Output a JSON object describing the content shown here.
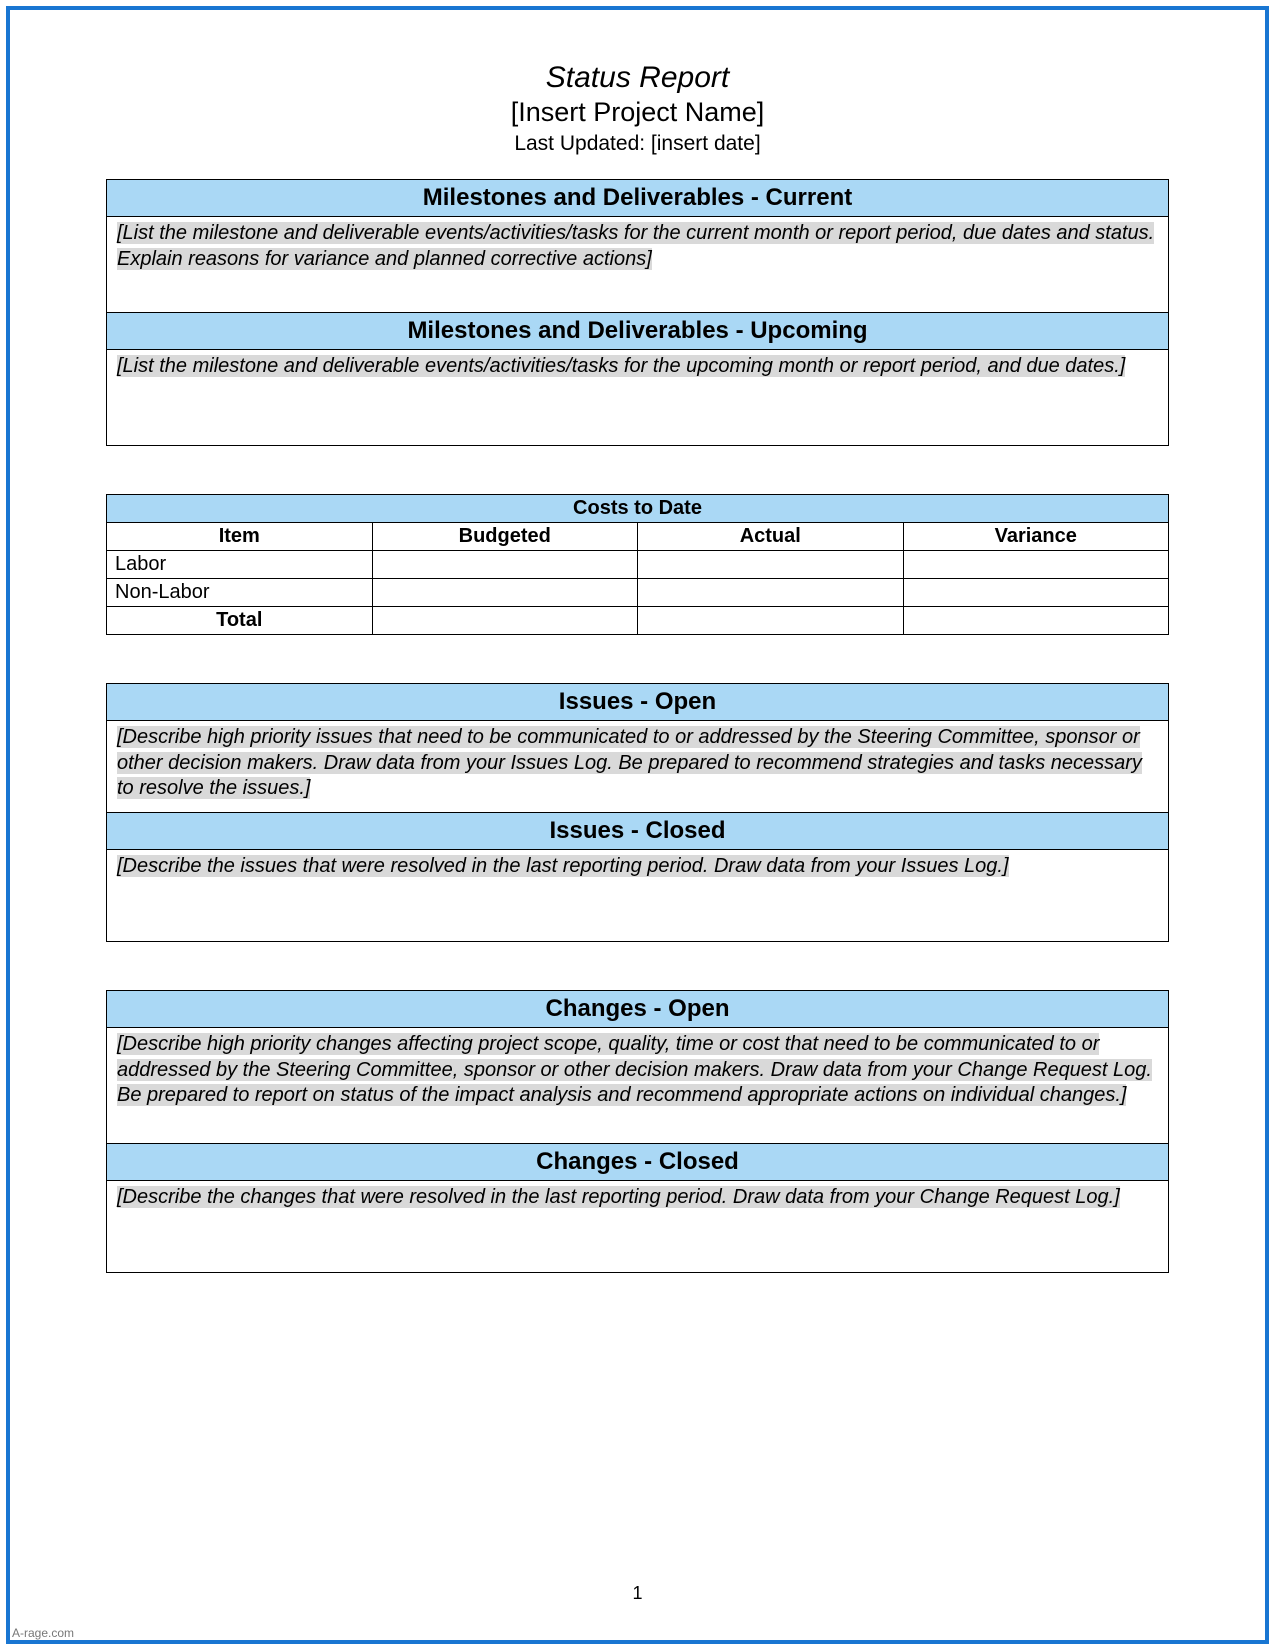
{
  "header": {
    "title": "Status Report",
    "project_name": "[Insert Project Name]",
    "last_updated_label": "Last Updated: [insert date]"
  },
  "milestones": {
    "current": {
      "title": "Milestones and Deliverables - Current",
      "body": "[List the milestone and deliverable events/activities/tasks for the current month or report period, due dates and status.  Explain reasons for variance and planned corrective actions]"
    },
    "upcoming": {
      "title": "Milestones and Deliverables - Upcoming",
      "body": "[List the milestone and deliverable events/activities/tasks for the upcoming month or report period, and due dates.]"
    }
  },
  "costs": {
    "title": "Costs to Date",
    "columns": {
      "item": "Item",
      "budgeted": "Budgeted",
      "actual": "Actual",
      "variance": "Variance"
    },
    "rows": [
      {
        "item": "Labor",
        "budgeted": "",
        "actual": "",
        "variance": ""
      },
      {
        "item": "Non-Labor",
        "budgeted": "",
        "actual": "",
        "variance": ""
      }
    ],
    "total_label": "Total"
  },
  "issues": {
    "open": {
      "title": "Issues - Open",
      "body": "[Describe high priority issues that need to be communicated to or addressed by the Steering Committee, sponsor or other decision makers.  Draw data from your Issues Log.  Be prepared to recommend strategies and tasks necessary to resolve the issues.]"
    },
    "closed": {
      "title": "Issues - Closed",
      "body": "[Describe the issues that were resolved in the last reporting period.  Draw data from your Issues Log.]"
    }
  },
  "changes": {
    "open": {
      "title": "Changes - Open",
      "body": "[Describe high priority changes affecting project scope, quality, time or cost that need to be communicated to or addressed by the Steering Committee, sponsor or other decision makers.  Draw data from your Change Request Log.  Be prepared to report on status of the impact analysis and recommend appropriate actions on individual changes.]"
    },
    "closed": {
      "title": "Changes - Closed",
      "body": "[Describe the changes that were resolved in the last reporting period.  Draw data from your Change Request Log.]"
    }
  },
  "page_number": "1",
  "watermark": "A-rage.com"
}
